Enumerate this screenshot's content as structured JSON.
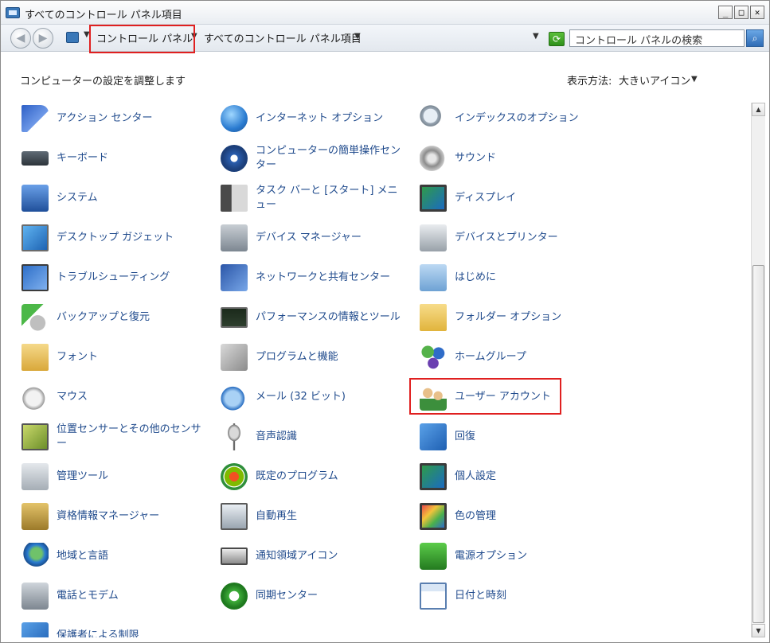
{
  "window": {
    "title": "すべてのコントロール パネル項目",
    "buttons": {
      "minimize": "_",
      "maximize": "□",
      "close": "✕"
    }
  },
  "addressbar": {
    "crumbs": [
      "コントロール パネル",
      "すべてのコントロール パネル項目"
    ],
    "search_placeholder": "コントロール パネルの検索"
  },
  "header": {
    "text": "コンピューターの設定を調整します",
    "view_label": "表示方法:",
    "view_value": "大きいアイコン"
  },
  "items": [
    {
      "label": "アクション センター",
      "icon": "action-center-icon"
    },
    {
      "label": "インターネット オプション",
      "icon": "internet-options-icon"
    },
    {
      "label": "インデックスのオプション",
      "icon": "indexing-options-icon"
    },
    {
      "label": "キーボード",
      "icon": "keyboard-icon"
    },
    {
      "label": "コンピューターの簡単操作センター",
      "icon": "ease-of-access-icon"
    },
    {
      "label": "サウンド",
      "icon": "sound-icon"
    },
    {
      "label": "システム",
      "icon": "system-icon"
    },
    {
      "label": "タスク バーと [スタート] メニュー",
      "icon": "taskbar-icon"
    },
    {
      "label": "ディスプレイ",
      "icon": "display-icon"
    },
    {
      "label": "デスクトップ ガジェット",
      "icon": "desktop-gadgets-icon"
    },
    {
      "label": "デバイス マネージャー",
      "icon": "device-manager-icon"
    },
    {
      "label": "デバイスとプリンター",
      "icon": "devices-printers-icon"
    },
    {
      "label": "トラブルシューティング",
      "icon": "troubleshooting-icon"
    },
    {
      "label": "ネットワークと共有センター",
      "icon": "network-sharing-icon"
    },
    {
      "label": "はじめに",
      "icon": "getting-started-icon"
    },
    {
      "label": "バックアップと復元",
      "icon": "backup-restore-icon"
    },
    {
      "label": "パフォーマンスの情報とツール",
      "icon": "performance-icon"
    },
    {
      "label": "フォルダー オプション",
      "icon": "folder-options-icon"
    },
    {
      "label": "フォント",
      "icon": "fonts-icon"
    },
    {
      "label": "プログラムと機能",
      "icon": "programs-features-icon"
    },
    {
      "label": "ホームグループ",
      "icon": "homegroup-icon"
    },
    {
      "label": "マウス",
      "icon": "mouse-icon"
    },
    {
      "label": "メール (32 ビット)",
      "icon": "mail-icon"
    },
    {
      "label": "ユーザー アカウント",
      "icon": "user-accounts-icon"
    },
    {
      "label": "位置センサーとその他のセンサー",
      "icon": "location-sensors-icon"
    },
    {
      "label": "音声認識",
      "icon": "speech-recognition-icon"
    },
    {
      "label": "回復",
      "icon": "recovery-icon"
    },
    {
      "label": "管理ツール",
      "icon": "admin-tools-icon"
    },
    {
      "label": "既定のプログラム",
      "icon": "default-programs-icon"
    },
    {
      "label": "個人設定",
      "icon": "personalization-icon"
    },
    {
      "label": "資格情報マネージャー",
      "icon": "credential-manager-icon"
    },
    {
      "label": "自動再生",
      "icon": "autoplay-icon"
    },
    {
      "label": "色の管理",
      "icon": "color-management-icon"
    },
    {
      "label": "地域と言語",
      "icon": "region-language-icon"
    },
    {
      "label": "通知領域アイコン",
      "icon": "notification-area-icon"
    },
    {
      "label": "電源オプション",
      "icon": "power-options-icon"
    },
    {
      "label": "電話とモデム",
      "icon": "phone-modem-icon"
    },
    {
      "label": "同期センター",
      "icon": "sync-center-icon"
    },
    {
      "label": "日付と時刻",
      "icon": "date-time-icon"
    },
    {
      "label": "保護者による制限",
      "icon": "parental-controls-icon"
    }
  ],
  "colors": {
    "link": "#1f4a8c",
    "highlight": "#e02020"
  }
}
